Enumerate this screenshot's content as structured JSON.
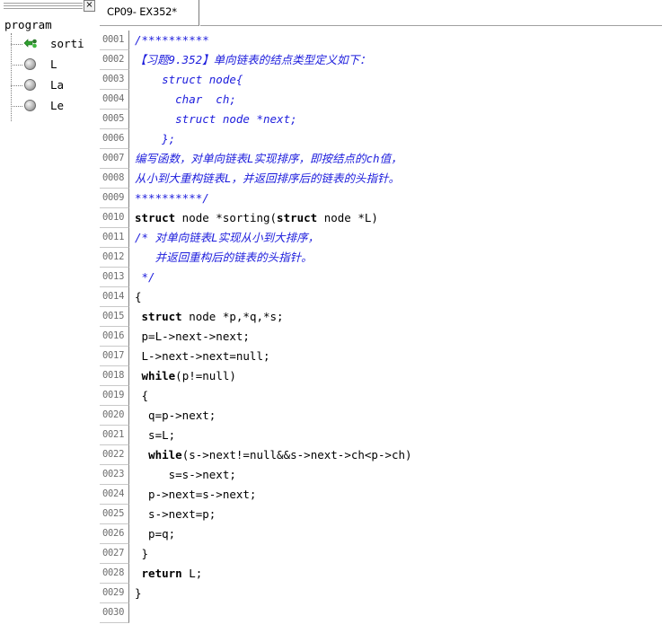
{
  "left_panel": {
    "close_glyph": "×",
    "root_label": "program",
    "items": [
      {
        "label": "sorti",
        "icon": "function-icon"
      },
      {
        "label": "L",
        "icon": "variable-icon"
      },
      {
        "label": "La",
        "icon": "variable-icon"
      },
      {
        "label": "Le",
        "icon": "variable-icon"
      }
    ]
  },
  "editor": {
    "tab_label": "CP09- EX352*",
    "lines": [
      {
        "n": "0001",
        "segs": [
          [
            "/**********",
            "c"
          ]
        ]
      },
      {
        "n": "0002",
        "segs": [
          [
            "【习题9.352】单向链表的结点类型定义如下：",
            "c"
          ]
        ]
      },
      {
        "n": "0003",
        "segs": [
          [
            "    struct node{",
            "c"
          ]
        ]
      },
      {
        "n": "0004",
        "segs": [
          [
            "      char  ch;",
            "c"
          ]
        ]
      },
      {
        "n": "0005",
        "segs": [
          [
            "      struct node *next;",
            "c"
          ]
        ]
      },
      {
        "n": "0006",
        "segs": [
          [
            "    };",
            "c"
          ]
        ]
      },
      {
        "n": "0007",
        "segs": [
          [
            "编写函数，对单向链表L实现排序，即按结点的ch值，",
            "c"
          ]
        ]
      },
      {
        "n": "0008",
        "segs": [
          [
            "从小到大重构链表L，并返回排序后的链表的头指针。",
            "c"
          ]
        ]
      },
      {
        "n": "0009",
        "segs": [
          [
            "**********/",
            "c"
          ]
        ]
      },
      {
        "n": "0010",
        "segs": [
          [
            "struct",
            "k"
          ],
          [
            " node *sorting(",
            "n"
          ],
          [
            "struct",
            "k"
          ],
          [
            " node *L)",
            "n"
          ]
        ]
      },
      {
        "n": "0011",
        "segs": [
          [
            "/* 对单向链表L实现从小到大排序，",
            "c"
          ]
        ]
      },
      {
        "n": "0012",
        "segs": [
          [
            "   并返回重构后的链表的头指针。",
            "c"
          ]
        ]
      },
      {
        "n": "0013",
        "segs": [
          [
            " */",
            "c"
          ]
        ]
      },
      {
        "n": "0014",
        "segs": [
          [
            "{",
            "n"
          ]
        ]
      },
      {
        "n": "0015",
        "segs": [
          [
            " ",
            "n"
          ],
          [
            "struct",
            "k"
          ],
          [
            " node *p,*q,*s;",
            "n"
          ]
        ]
      },
      {
        "n": "0016",
        "segs": [
          [
            " p=L->next->next;",
            "n"
          ]
        ]
      },
      {
        "n": "0017",
        "segs": [
          [
            " L->next->next=null;",
            "n"
          ]
        ]
      },
      {
        "n": "0018",
        "segs": [
          [
            " ",
            "n"
          ],
          [
            "while",
            "k"
          ],
          [
            "(p!=null)",
            "n"
          ]
        ]
      },
      {
        "n": "0019",
        "segs": [
          [
            " {",
            "n"
          ]
        ]
      },
      {
        "n": "0020",
        "segs": [
          [
            "  q=p->next;",
            "n"
          ]
        ]
      },
      {
        "n": "0021",
        "segs": [
          [
            "  s=L;",
            "n"
          ]
        ]
      },
      {
        "n": "0022",
        "segs": [
          [
            "  ",
            "n"
          ],
          [
            "while",
            "k"
          ],
          [
            "(s->next!=null&&s->next->ch<p->ch)",
            "n"
          ]
        ]
      },
      {
        "n": "0023",
        "segs": [
          [
            "     s=s->next;",
            "n"
          ]
        ]
      },
      {
        "n": "0024",
        "segs": [
          [
            "  p->next=s->next;",
            "n"
          ]
        ]
      },
      {
        "n": "0025",
        "segs": [
          [
            "  s->next=p;",
            "n"
          ]
        ]
      },
      {
        "n": "0026",
        "segs": [
          [
            "  p=q;",
            "n"
          ]
        ]
      },
      {
        "n": "0027",
        "segs": [
          [
            " }",
            "n"
          ]
        ]
      },
      {
        "n": "0028",
        "segs": [
          [
            " ",
            "n"
          ],
          [
            "return",
            "k"
          ],
          [
            " L;",
            "n"
          ]
        ]
      },
      {
        "n": "0029",
        "segs": [
          [
            "}",
            "n"
          ]
        ]
      },
      {
        "n": "0030",
        "segs": [
          [
            "",
            "n"
          ]
        ]
      }
    ]
  }
}
